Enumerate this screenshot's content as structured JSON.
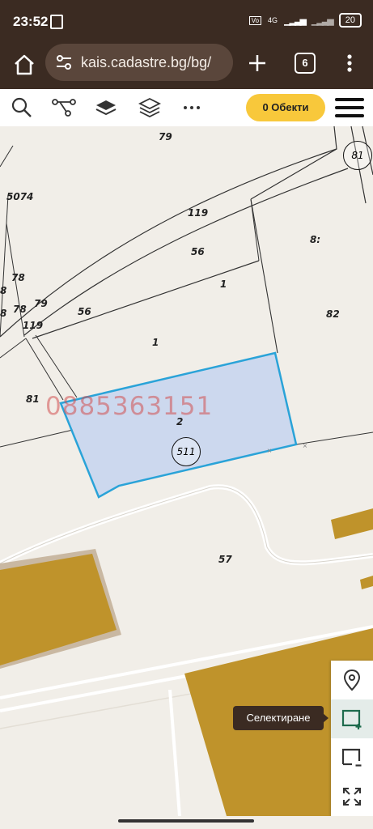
{
  "status": {
    "time": "23:52",
    "network": "4G",
    "battery": "20"
  },
  "browser": {
    "url": "kais.cadastre.bg/bg/",
    "tab_count": "6"
  },
  "toolbar": {
    "objects_label": "0 Обекти"
  },
  "map": {
    "watermark": "0885363151",
    "selected_parcel": "511",
    "labels": {
      "l79": "79",
      "l81c": "81",
      "l5074": "5074",
      "l119a": "119",
      "l56a": "56",
      "l8x": "8:",
      "l1a": "1",
      "l78a": "78",
      "l8a": "8",
      "l78b": "78",
      "l79b": "79",
      "l8b": "8",
      "l56b": "56",
      "l82": "82",
      "l119b": "119",
      "l1b": "1",
      "l81": "81",
      "l2": "2",
      "l57": "57"
    }
  },
  "side_tools": {
    "select_tooltip": "Селектиране"
  },
  "icons": {
    "home": "home-icon",
    "tune": "tune-icon",
    "plus": "plus-icon",
    "more": "more-vertical-icon",
    "search": "search-icon",
    "route": "route-icon",
    "layers": "layers-icon",
    "layers-outline": "layers-outline-icon",
    "more-horizontal": "more-horizontal-icon",
    "hamburger": "hamburger-icon",
    "pin": "location-pin-icon",
    "select": "select-area-icon",
    "deselect": "deselect-area-icon",
    "fullscreen": "fullscreen-icon"
  },
  "colors": {
    "browser_chrome": "#3b2b22",
    "objects_button": "#f8c83b",
    "selected_parcel_fill": "#c6d4ee",
    "selected_parcel_stroke": "#2aa3d8",
    "building": "#bf932b"
  }
}
